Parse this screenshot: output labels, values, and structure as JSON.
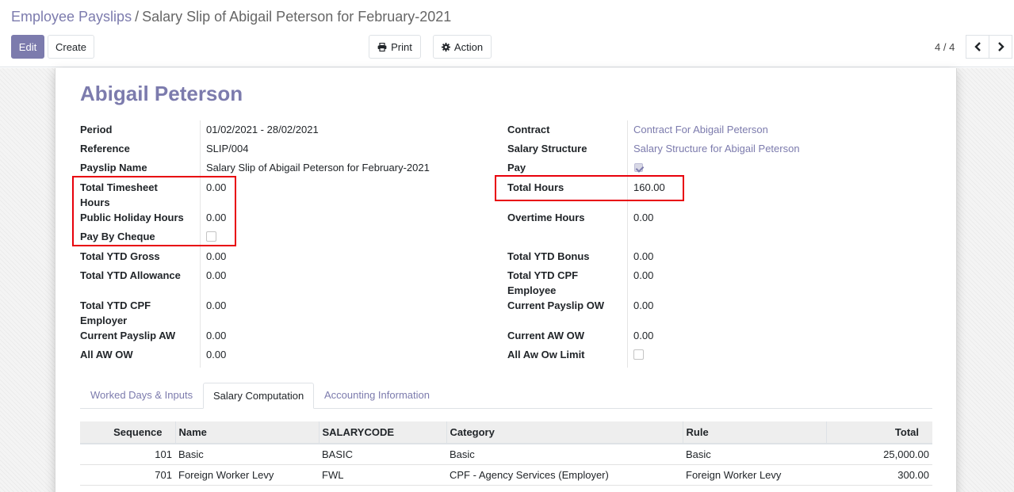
{
  "breadcrumb": {
    "parent": "Employee Payslips",
    "separator": "/",
    "current": "Salary Slip of Abigail Peterson for February-2021"
  },
  "toolbar": {
    "edit": "Edit",
    "create": "Create",
    "print": "Print",
    "action": "Action",
    "pager": "4 / 4"
  },
  "icons": {
    "print": "printer-icon",
    "action": "gear-icon",
    "prev": "chevron-left-icon",
    "next": "chevron-right-icon"
  },
  "colors": {
    "accent": "#7c7bad",
    "highlight": "#e8000b"
  },
  "employee_name": "Abigail Peterson",
  "left_fields": {
    "period_label": "Period",
    "period_value": "01/02/2021 - 28/02/2021",
    "reference_label": "Reference",
    "reference_value": "SLIP/004",
    "payslip_name_label": "Payslip Name",
    "payslip_name_value": "Salary Slip of Abigail Peterson for February-2021",
    "timesheet_label_1": "Total Timesheet",
    "timesheet_label_2": "Hours",
    "timesheet_value": "0.00",
    "public_holiday_label": "Public Holiday Hours",
    "public_holiday_value": "0.00",
    "pay_by_cheque_label": "Pay By Cheque",
    "pay_by_cheque_checked": false,
    "ytd_gross_label": "Total YTD Gross",
    "ytd_gross_value": "0.00",
    "ytd_allowance_label": "Total YTD Allowance",
    "ytd_allowance_value": "0.00",
    "ytd_cpf_employer_label_1": "Total YTD CPF",
    "ytd_cpf_employer_label_2": "Employer",
    "ytd_cpf_employer_value": "0.00",
    "current_payslip_aw_label": "Current Payslip AW",
    "current_payslip_aw_value": "0.00",
    "all_aw_ow_label": "All AW OW",
    "all_aw_ow_value": "0.00"
  },
  "right_fields": {
    "contract_label": "Contract",
    "contract_value": "Contract For Abigail Peterson",
    "structure_label": "Salary Structure",
    "structure_value": "Salary Structure for Abigail Peterson",
    "pay_label": "Pay",
    "pay_checked": true,
    "total_hours_label": "Total Hours",
    "total_hours_value": "160.00",
    "overtime_label": "Overtime Hours",
    "overtime_value": "0.00",
    "ytd_bonus_label": "Total YTD Bonus",
    "ytd_bonus_value": "0.00",
    "ytd_cpf_employee_label_1": "Total YTD CPF",
    "ytd_cpf_employee_label_2": "Employee",
    "ytd_cpf_employee_value": "0.00",
    "current_payslip_ow_label": "Current Payslip OW",
    "current_payslip_ow_value": "0.00",
    "current_aw_ow_label": "Current AW OW",
    "current_aw_ow_value": "0.00",
    "all_aw_ow_limit_label": "All Aw Ow Limit",
    "all_aw_ow_limit_checked": false
  },
  "tabs": [
    {
      "label": "Worked Days & Inputs",
      "active": false
    },
    {
      "label": "Salary Computation",
      "active": true
    },
    {
      "label": "Accounting Information",
      "active": false
    }
  ],
  "table": {
    "headers": [
      "Sequence",
      "Name",
      "SALARYCODE",
      "Category",
      "Rule",
      "Total"
    ],
    "rows": [
      [
        "101",
        "Basic",
        "BASIC",
        "Basic",
        "Basic",
        "25,000.00"
      ],
      [
        "701",
        "Foreign Worker Levy",
        "FWL",
        "CPF - Agency Services (Employer)",
        "Foreign Worker Levy",
        "300.00"
      ]
    ]
  }
}
